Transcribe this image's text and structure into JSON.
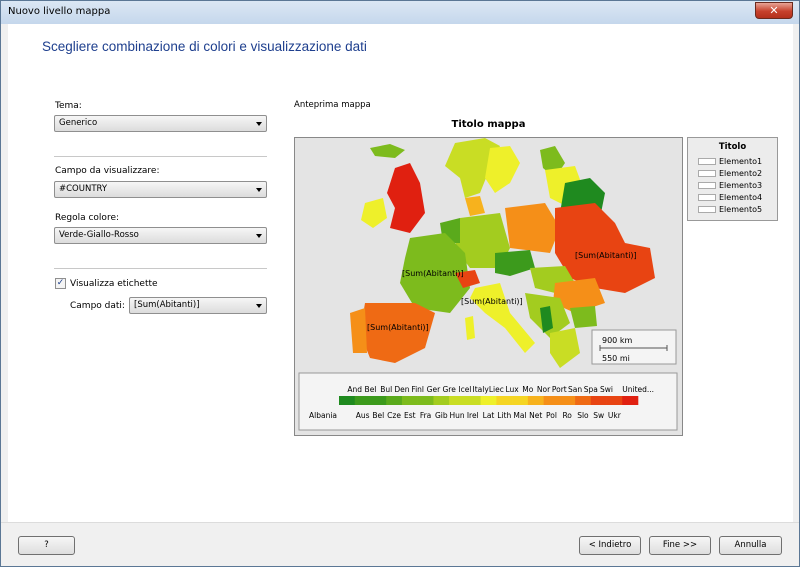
{
  "window": {
    "title": "Nuovo livello mappa",
    "close_glyph": "✕"
  },
  "heading": "Scegliere combinazione di colori e visualizzazione dati",
  "form": {
    "tema_label": "Tema:",
    "tema_value": "Generico",
    "campo_label": "Campo da visualizzare:",
    "campo_value": "#COUNTRY",
    "regola_label": "Regola colore:",
    "regola_value": "Verde-Giallo-Rosso",
    "etichette_checked": "✓",
    "etichette_label": "Visualizza etichette",
    "campo_dati_label": "Campo dati:",
    "campo_dati_value": "[Sum(Abitanti)]"
  },
  "preview": {
    "label": "Anteprima mappa",
    "map_title": "Titolo mappa",
    "data_labels": [
      "[Sum(Abitanti)]",
      "[Sum(Abitanti)]",
      "[Sum(Abitanti)]",
      "[Sum(Abitanti)]"
    ],
    "scale_km": "900 km",
    "scale_mi": "550 mi",
    "color_scale": {
      "top_labels": [
        "And",
        "Bel",
        "Bul",
        "Den",
        "Finl",
        "Ger",
        "Gre",
        "Icel",
        "Italy",
        "Liec",
        "Lux",
        "Mo",
        "Nor",
        "Port",
        "San",
        "Spa",
        "Swi",
        "United..."
      ],
      "bottom_labels": [
        "Albania",
        "Aus",
        "Bel",
        "Cze",
        "Est",
        "Fra",
        "Gib",
        "Hun",
        "Irel",
        "Lat",
        "Lith",
        "Mal",
        "Net",
        "Pol",
        "Ro",
        "Slo",
        "Sw",
        "Ukr"
      ]
    }
  },
  "legend": {
    "title": "Titolo",
    "items": [
      "Elemento1",
      "Elemento2",
      "Elemento3",
      "Elemento4",
      "Elemento5"
    ]
  },
  "buttons": {
    "help": "?",
    "back": "< Indietro",
    "finish": "Fine >>",
    "cancel": "Annulla"
  },
  "colors": {
    "heading": "#1e3f8e",
    "ramp": [
      "#1f8a1f",
      "#3c9a1c",
      "#5aaa1c",
      "#7dbb1d",
      "#a3cc1f",
      "#c9dd24",
      "#eef02a",
      "#f5d523",
      "#f7b21d",
      "#f58f18",
      "#ef6a14",
      "#e84412",
      "#e02010"
    ]
  }
}
